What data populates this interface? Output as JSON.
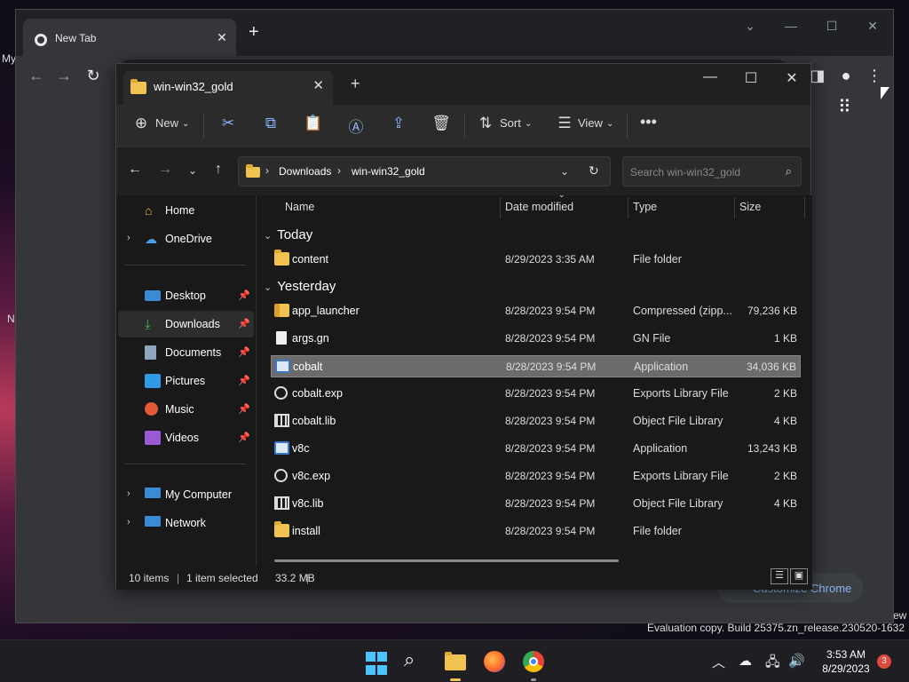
{
  "desktop": {
    "frag_my": "My",
    "frag_n": "N",
    "frag_ew": "ew"
  },
  "chrome": {
    "tab_title": "New Tab",
    "customize_label": "Customize Chrome"
  },
  "explorer": {
    "tab_title": "win-win32_gold",
    "cmd": {
      "new_label": "New",
      "sort_label": "Sort",
      "view_label": "View"
    },
    "breadcrumb": [
      "Downloads",
      "win-win32_gold"
    ],
    "search_placeholder": "Search win-win32_gold",
    "nav": {
      "home": "Home",
      "onedrive": "OneDrive",
      "desktop": "Desktop",
      "downloads": "Downloads",
      "documents": "Documents",
      "pictures": "Pictures",
      "music": "Music",
      "videos": "Videos",
      "mycomputer": "My Computer",
      "network": "Network"
    },
    "columns": {
      "name": "Name",
      "date": "Date modified",
      "type": "Type",
      "size": "Size"
    },
    "groups": {
      "today": "Today",
      "yesterday": "Yesterday"
    },
    "rows": [
      {
        "name": "content",
        "date": "8/29/2023 3:35 AM",
        "type": "File folder",
        "size": "",
        "icon": "folder-icon"
      },
      {
        "name": "app_launcher",
        "date": "8/28/2023 9:54 PM",
        "type": "Compressed (zipp...",
        "size": "79,236 KB",
        "icon": "zip-folder-icon"
      },
      {
        "name": "args.gn",
        "date": "8/28/2023 9:54 PM",
        "type": "GN File",
        "size": "1 KB",
        "icon": "file-icon"
      },
      {
        "name": "cobalt",
        "date": "8/28/2023 9:54 PM",
        "type": "Application",
        "size": "34,036 KB",
        "icon": "application-icon"
      },
      {
        "name": "cobalt.exp",
        "date": "8/28/2023 9:54 PM",
        "type": "Exports Library File",
        "size": "2 KB",
        "icon": "gear-file-icon"
      },
      {
        "name": "cobalt.lib",
        "date": "8/28/2023 9:54 PM",
        "type": "Object File Library",
        "size": "4 KB",
        "icon": "library-file-icon"
      },
      {
        "name": "v8c",
        "date": "8/28/2023 9:54 PM",
        "type": "Application",
        "size": "13,243 KB",
        "icon": "application-icon"
      },
      {
        "name": "v8c.exp",
        "date": "8/28/2023 9:54 PM",
        "type": "Exports Library File",
        "size": "2 KB",
        "icon": "gear-file-icon"
      },
      {
        "name": "v8c.lib",
        "date": "8/28/2023 9:54 PM",
        "type": "Object File Library",
        "size": "4 KB",
        "icon": "library-file-icon"
      },
      {
        "name": "install",
        "date": "8/28/2023 9:54 PM",
        "type": "File folder",
        "size": "",
        "icon": "folder-icon"
      }
    ],
    "selected_row": 3,
    "status": {
      "items": "10 items",
      "selected": "1 item selected",
      "size": "33.2 MB"
    }
  },
  "watermark": "Evaluation copy. Build 25375.zn_release.230520-1632",
  "taskbar": {
    "time": "3:53 AM",
    "date": "8/29/2023",
    "notifications": "3"
  },
  "colors": {
    "accent": "#4cc2ff",
    "folder": "#f0c24f",
    "link": "#8ab4f8"
  }
}
